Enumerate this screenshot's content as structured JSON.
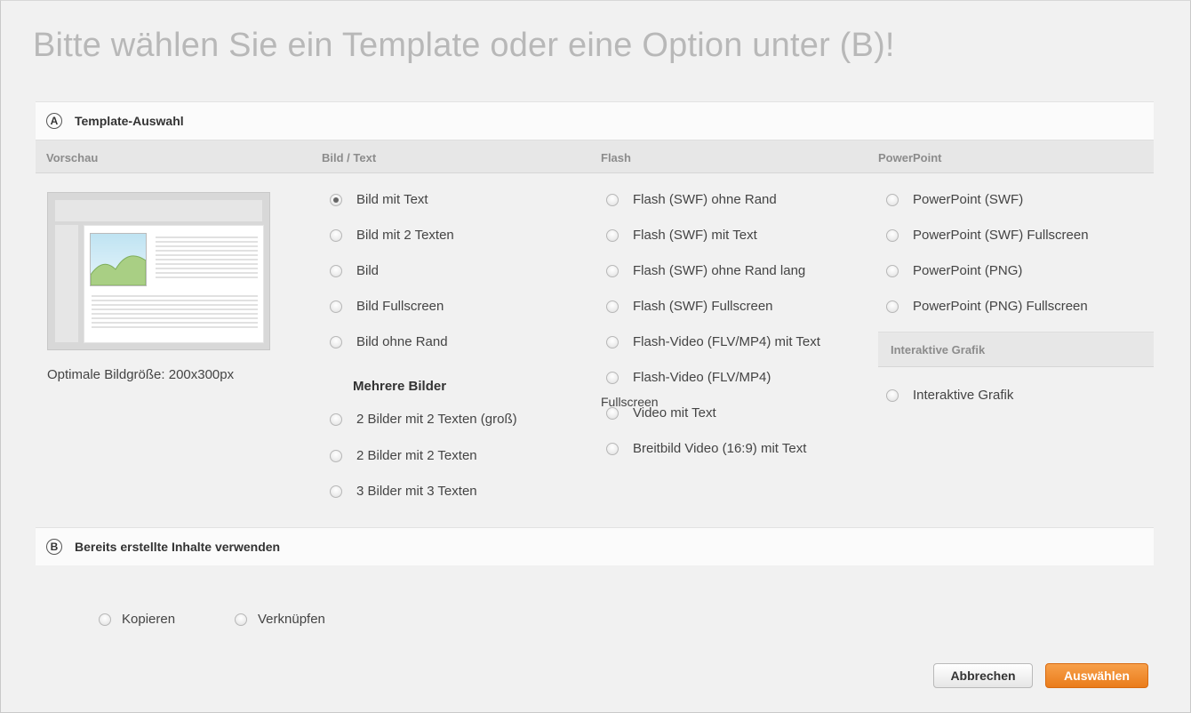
{
  "title": "Bitte wählen Sie ein Template oder eine Option unter (B)!",
  "sectionA": {
    "letter": "A",
    "title": "Template-Auswahl"
  },
  "columns": {
    "preview": "Vorschau",
    "bildtext": "Bild / Text",
    "flash": "Flash",
    "powerpoint": "PowerPoint"
  },
  "preview": {
    "caption": "Optimale Bildgröße: 200x300px"
  },
  "bildtext": {
    "options": [
      "Bild mit Text",
      "Bild mit 2 Texten",
      "Bild",
      "Bild Fullscreen",
      "Bild ohne Rand"
    ],
    "selected_index": 0,
    "subhead": "Mehrere Bilder",
    "multi": [
      "2 Bilder mit 2 Texten (groß)",
      "2 Bilder mit 2 Texten",
      "3 Bilder mit 3 Texten"
    ]
  },
  "flash": {
    "options": [
      "Flash (SWF) ohne Rand",
      "Flash (SWF) mit Text",
      "Flash (SWF) ohne Rand lang",
      "Flash (SWF) Fullscreen",
      "Flash-Video (FLV/MP4) mit Text",
      "Flash-Video (FLV/MP4)",
      "Video mit Text",
      "Breitbild Video (16:9) mit Text"
    ],
    "overlap_text": "Fullscreen"
  },
  "powerpoint": {
    "options": [
      "PowerPoint (SWF)",
      "PowerPoint (SWF) Fullscreen",
      "PowerPoint (PNG)",
      "PowerPoint (PNG) Fullscreen"
    ]
  },
  "interactive": {
    "header": "Interaktive Grafik",
    "option": "Interaktive Grafik"
  },
  "sectionB": {
    "letter": "B",
    "title": "Bereits erstellte Inhalte verwenden",
    "options": [
      "Kopieren",
      "Verknüpfen"
    ]
  },
  "buttons": {
    "cancel": "Abbrechen",
    "select": "Auswählen"
  },
  "colors": {
    "accent": "#ea7c1b",
    "title_gray": "#b8b8b8"
  }
}
